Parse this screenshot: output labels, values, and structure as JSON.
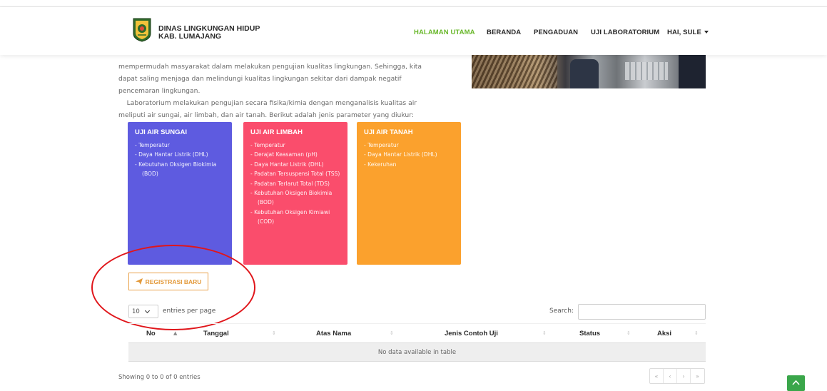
{
  "header": {
    "brand_line1": "DINAS LINGKUNGAN HIDUP",
    "brand_line2": "KAB. LUMAJANG",
    "nav": [
      {
        "label": "HALAMAN UTAMA",
        "active": true
      },
      {
        "label": "BERANDA"
      },
      {
        "label": "PENGADUAN"
      },
      {
        "label": "UJI LABORATORIUM"
      },
      {
        "label": "HAI, SULE"
      }
    ],
    "accent_color": "#6ab82c"
  },
  "intro": {
    "p1_line1": "mempermudah masyarakat dalam melakukan pengujian kualitas lingkungan. Sehingga, kita",
    "p1_line2": "dapat saling menjaga dan melindungi kualitas lingkungan sekitar dari dampak negatif",
    "p1_line3": "pencemaran lingkungan.",
    "p2_line1": "    Laboratorium melakukan pengujian secara fisika/kimia dengan menganalisis kualitas air",
    "p2_line2": "meliputi air sungai, air limbah, dan air tanah. Berikut adalah jenis parameter yang diukur:"
  },
  "cards": [
    {
      "title": "UJI AIR SUNGAI",
      "color": "#5e5be0",
      "items": [
        "Temperatur",
        "Daya Hantar Listrik (DHL)",
        "Kebutuhan Oksigen Biokimia (BOD)"
      ]
    },
    {
      "title": "UJI AIR LIMBAH",
      "color": "#fa4d6c",
      "items": [
        "Temperatur",
        "Derajat Keasaman (pH)",
        "Daya Hantar Listrik (DHL)",
        "Padatan Tersuspensi Total (TSS)",
        "Padatan Terlarut Total (TDS)",
        "Kebutuhan Oksigen Biokimia (BOD)",
        "Kebutuhan Oksigen Kimiawi (COD)"
      ]
    },
    {
      "title": "UJI AIR TANAH",
      "color": "#fba12d",
      "items": [
        "Temperatur",
        "Daya Hantar Listrik (DHL)",
        "Kekeruhan"
      ]
    }
  ],
  "register_button": {
    "label": "REGISTRASI BARU",
    "icon": "paper-plane-icon"
  },
  "table": {
    "length_value": "10",
    "length_label": "entries per page",
    "search_label": "Search:",
    "search_value": "",
    "columns": [
      "No",
      "Tanggal",
      "Atas Nama",
      "Jenis Contoh Uji",
      "Status",
      "Aksi"
    ],
    "empty_text": "No data available in table",
    "info": "Showing 0 to 0 of 0 entries",
    "pager": [
      "«",
      "‹",
      "›",
      "»"
    ]
  }
}
